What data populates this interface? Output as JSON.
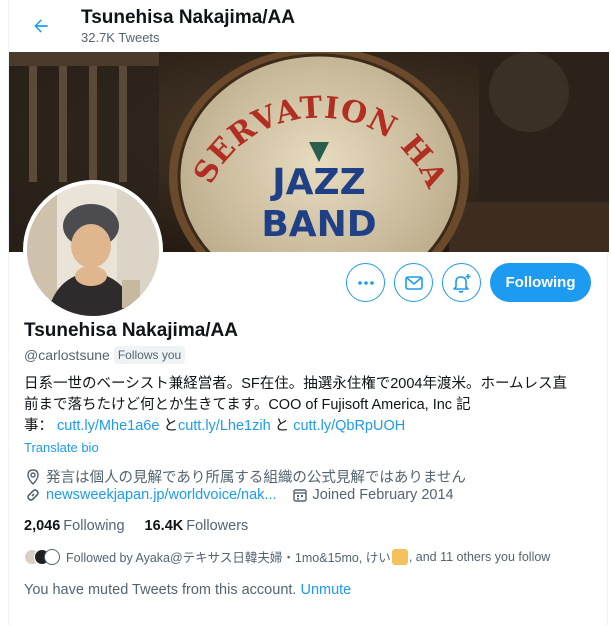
{
  "header": {
    "name": "Tsunehisa Nakajima/AA",
    "tweet_count": "32.7K Tweets"
  },
  "banner": {
    "drum_top_text": "RESERVATION HALL",
    "drum_line1": "JAZZ",
    "drum_line2": "BAND"
  },
  "actions": {
    "follow_label": "Following"
  },
  "profile": {
    "name": "Tsunehisa Nakajima/AA",
    "handle": "@carlostsune",
    "follows_you": "Follows you",
    "bio_line1": "日系一世のベーシスト兼経営者。SF在住。抽選永住権で2004年渡米。ホームレス直",
    "bio_line2": "前まで落ちたけど何とか生きてます。COO of Fujisoft America, Inc 記",
    "bio_prefix": "事：",
    "bio_link1": "cutt.ly/Mhe1a6e",
    "bio_sep1": " と",
    "bio_link2": "cutt.ly/Lhe1zih",
    "bio_sep2": " と ",
    "bio_link3": "cutt.ly/QbRpUOH",
    "translate": "Translate bio",
    "location": "発言は個人の見解であり所属する組織の公式見解ではありません",
    "website": "newsweekjapan.jp/worldvoice/nak...",
    "joined": "Joined February 2014"
  },
  "stats": {
    "following_count": "2,046",
    "following_label": "Following",
    "followers_count": "16.4K",
    "followers_label": "Followers"
  },
  "followers_you_know": {
    "text_a": "Followed by Ayaka@テキサス日韓夫婦・1mo&15mo, けい",
    "text_b": ", and 11 others you follow"
  },
  "muted": {
    "text": "You have muted Tweets from this account.",
    "unmute": "Unmute"
  },
  "colors": {
    "accent": "#1d9bf0",
    "text_primary": "#0f1419",
    "text_secondary": "#536471"
  }
}
